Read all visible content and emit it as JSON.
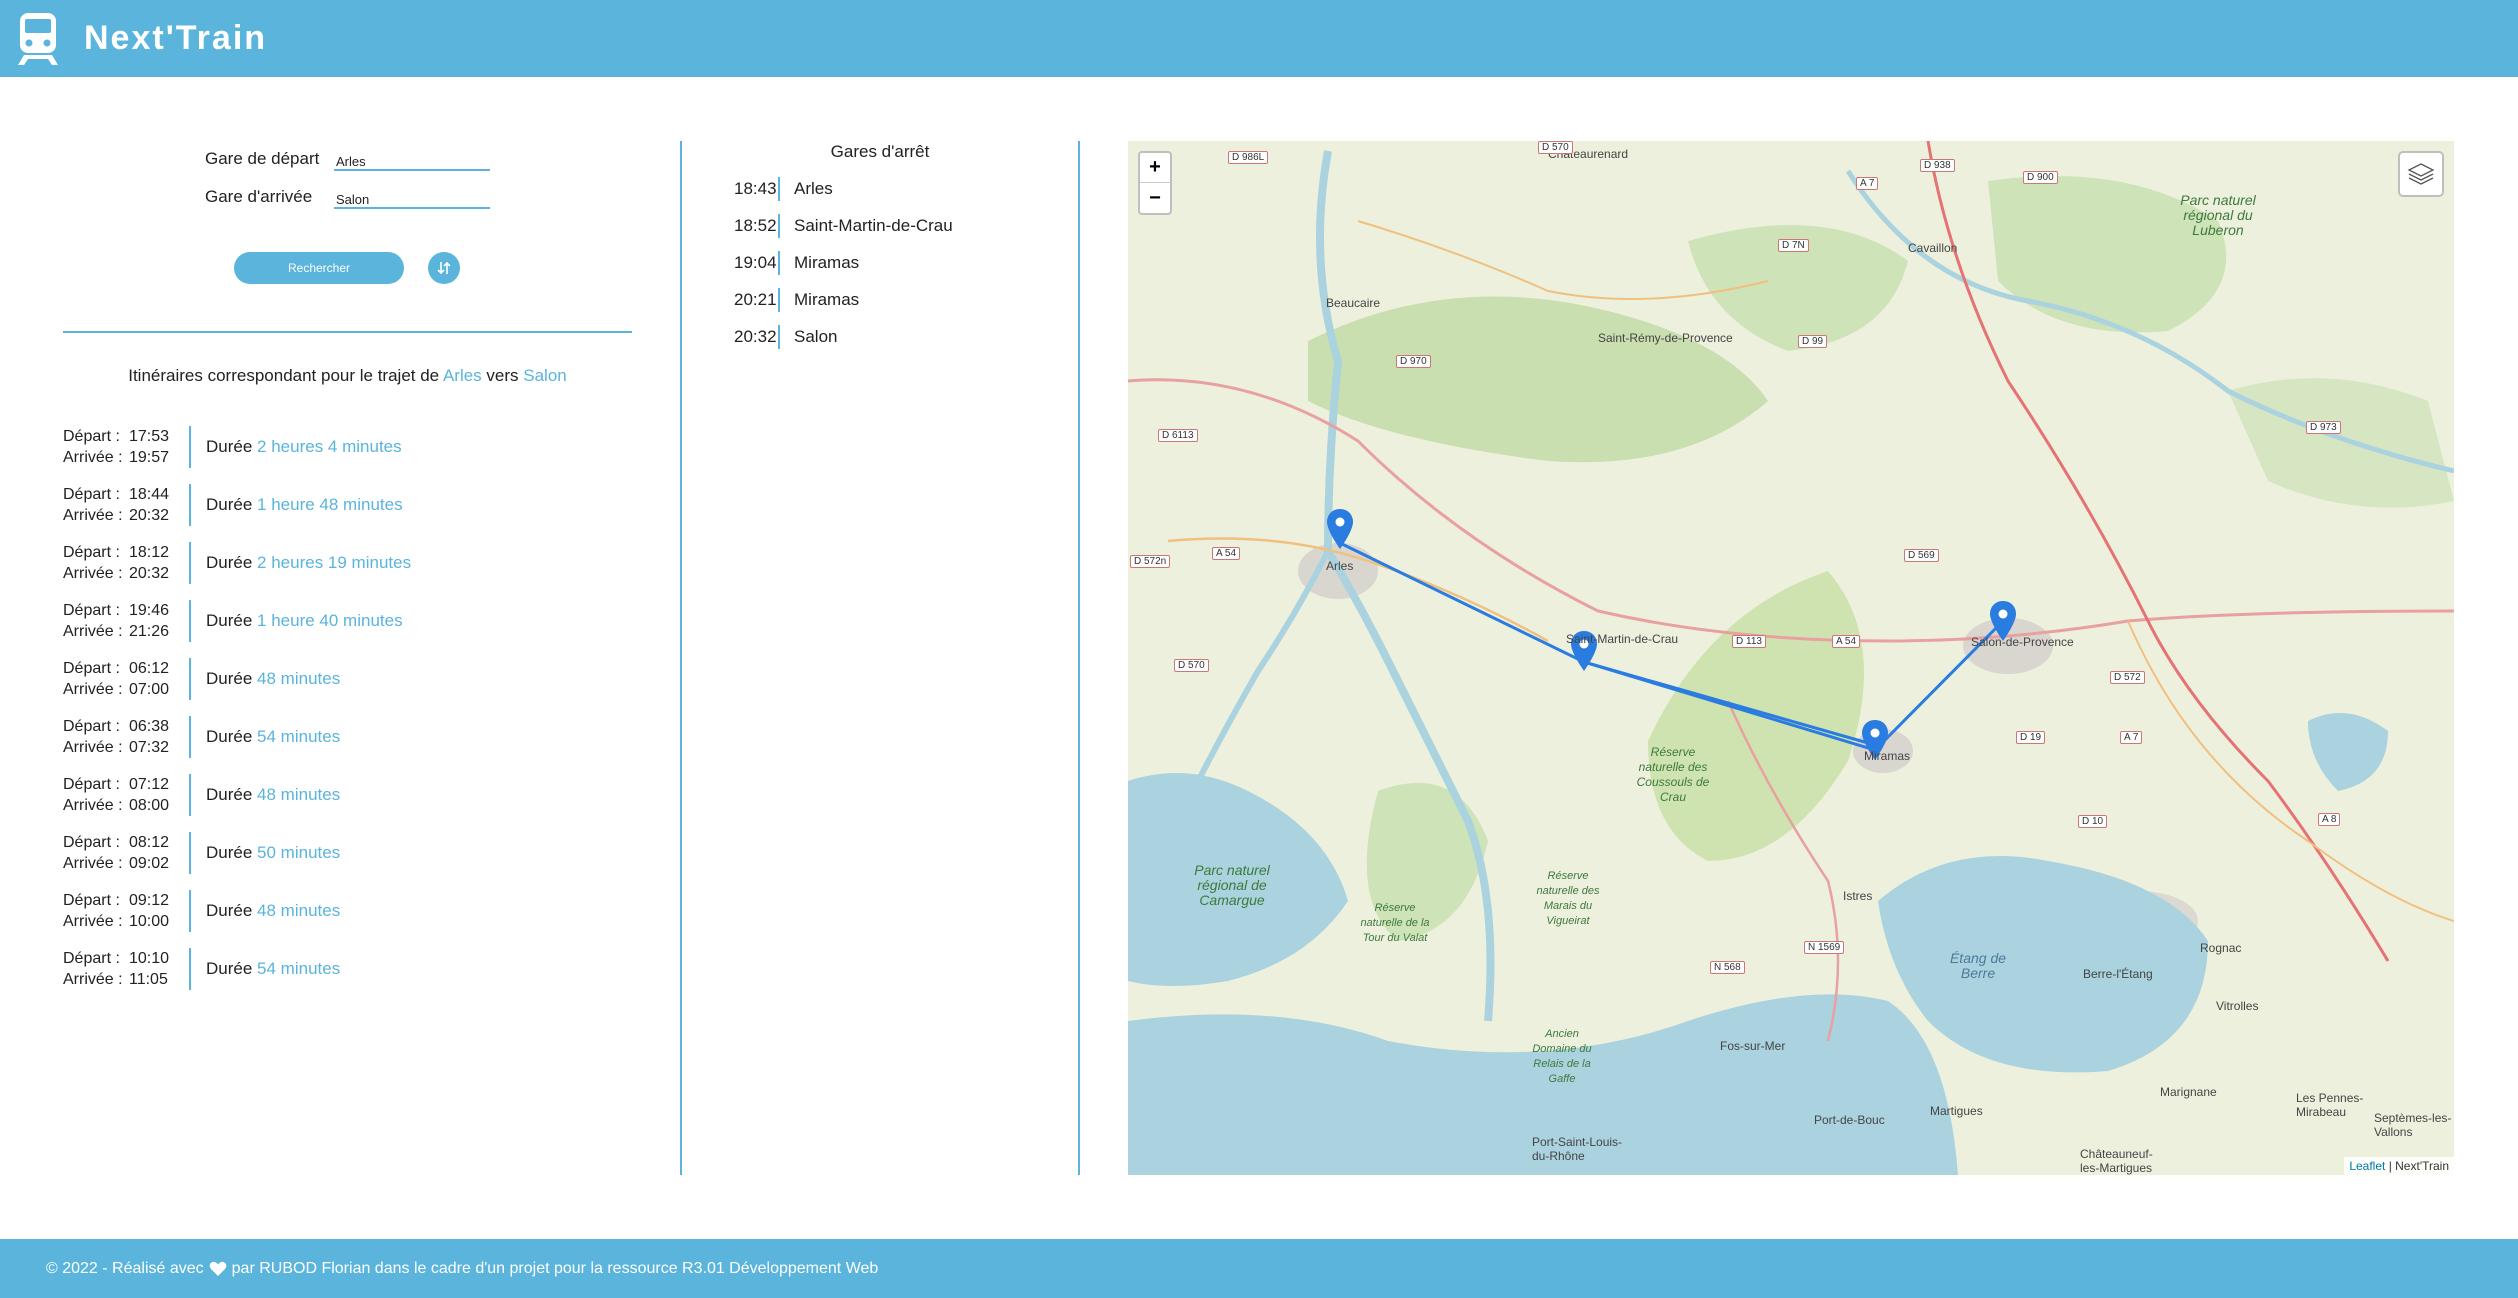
{
  "app": {
    "title": "Next'Train"
  },
  "search": {
    "departure_label": "Gare de départ",
    "departure_value": "Arles",
    "arrival_label": "Gare d'arrivée",
    "arrival_value": "Salon",
    "search_button": "Rechercher",
    "swap_icon": "swap-vertical-icon"
  },
  "results": {
    "title_prefix": "Itinéraires correspondant pour le trajet de",
    "from": "Arles",
    "connector": "vers",
    "to": "Salon",
    "dep_label": "Départ :",
    "arr_label": "Arrivée :",
    "duration_label": "Durée",
    "items": [
      {
        "dep": "17:53",
        "arr": "19:57",
        "duration": "2 heures 4 minutes"
      },
      {
        "dep": "18:44",
        "arr": "20:32",
        "duration": "1 heure 48 minutes"
      },
      {
        "dep": "18:12",
        "arr": "20:32",
        "duration": "2 heures 19 minutes"
      },
      {
        "dep": "19:46",
        "arr": "21:26",
        "duration": "1 heure 40 minutes"
      },
      {
        "dep": "06:12",
        "arr": "07:00",
        "duration": "48 minutes"
      },
      {
        "dep": "06:38",
        "arr": "07:32",
        "duration": "54 minutes"
      },
      {
        "dep": "07:12",
        "arr": "08:00",
        "duration": "48 minutes"
      },
      {
        "dep": "08:12",
        "arr": "09:02",
        "duration": "50 minutes"
      },
      {
        "dep": "09:12",
        "arr": "10:00",
        "duration": "48 minutes"
      },
      {
        "dep": "10:10",
        "arr": "11:05",
        "duration": "54 minutes"
      }
    ]
  },
  "stops": {
    "title": "Gares d'arrêt",
    "items": [
      {
        "time": "18:43",
        "name": "Arles"
      },
      {
        "time": "18:52",
        "name": "Saint-Martin-de-Crau"
      },
      {
        "time": "19:04",
        "name": "Miramas"
      },
      {
        "time": "20:21",
        "name": "Miramas"
      },
      {
        "time": "20:32",
        "name": "Salon"
      }
    ]
  },
  "map": {
    "zoom_in": "+",
    "zoom_out": "−",
    "attribution_leaflet": "Leaflet",
    "attribution_rest": "| Next'Train",
    "route_color": "#2a7ce0",
    "labels": {
      "arles": "Arles",
      "smdc": "Saint-Martin-de-Crau",
      "miramas": "Miramas",
      "salon": "Salon-de-Provence",
      "beaucaire": "Beaucaire",
      "st_remy": "Saint-Rémy-de-Provence",
      "chateaurenard": "Châteaurenard",
      "cavaillon": "Cavaillon",
      "istres": "Istres",
      "fos": "Fos-sur-Mer",
      "port_de_bouc": "Port-de-Bouc",
      "martigues": "Martigues",
      "berre": "Berre-l'Étang",
      "rognac": "Rognac",
      "vitrolles": "Vitrolles",
      "marignane": "Marignane",
      "pennes": "Les Pennes-Mirabeau",
      "septemes": "Septèmes-les-Vallons",
      "chateauneuf": "Châteauneuf-les-Martigues",
      "port_st_louis": "Port-Saint-Louis-du-Rhône",
      "luberon": "Parc naturel régional du Luberon",
      "camargue": "Parc naturel régional de Camargue",
      "coussouls": "Réserve naturelle des Coussouls de Crau",
      "etang_berre": "Étang de Berre",
      "vigueirat": "Réserve naturelle des Marais du Vigueirat",
      "vaccares": "Réserve naturelle de la Tour du Valat",
      "gavelle": "Ancien Domaine du Relais de la Gaffe"
    },
    "roads": [
      "D 570",
      "D 938",
      "D 900",
      "A 7",
      "D 7N",
      "D 99",
      "D 970",
      "D 6113",
      "A 54",
      "D 572n",
      "D 569",
      "D 113",
      "A 54",
      "D 973",
      "D 570",
      "D 19",
      "A 7",
      "D 572",
      "D 10",
      "A 8",
      "N 568",
      "N 1569",
      "D 986L"
    ]
  },
  "footer": {
    "text_before": "© 2022 - Réalisé avec",
    "heart_icon": "heart-icon",
    "text_after": "par RUBOD Florian dans le cadre d'un projet pour la ressource R3.01 Développement Web"
  }
}
